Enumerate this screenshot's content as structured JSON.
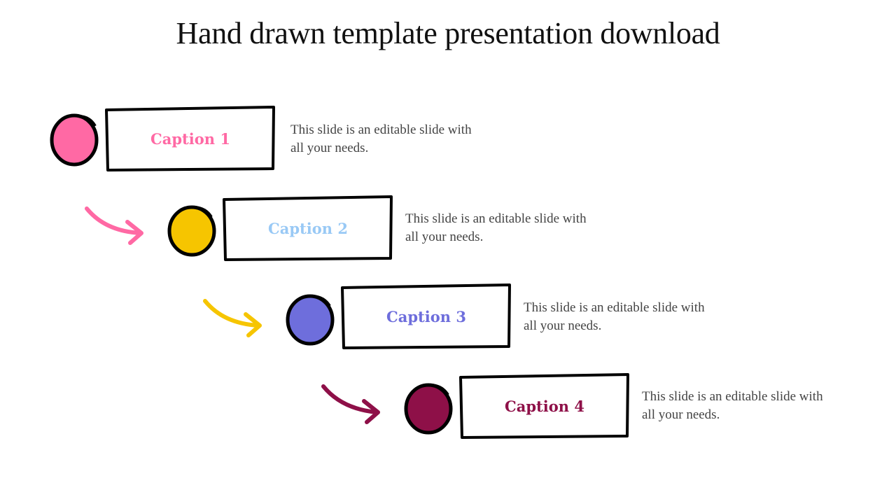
{
  "title": "Hand drawn template presentation download",
  "steps": [
    {
      "caption": "Caption 1",
      "description": "This slide is an editable slide with all your needs.",
      "dot_color": "#ff69a4",
      "caption_color": "#ff69a4",
      "arrow_color": null
    },
    {
      "caption": "Caption 2",
      "description": "This slide is an editable slide with all your needs.",
      "dot_color": "#f6c500",
      "caption_color": "#99c9f5",
      "arrow_color": "#ff69a4"
    },
    {
      "caption": "Caption 3",
      "description": "This slide is an editable slide with all your needs.",
      "dot_color": "#6e6edc",
      "caption_color": "#6e6edc",
      "arrow_color": "#f6c500"
    },
    {
      "caption": "Caption 4",
      "description": "This slide is an editable slide with all your needs.",
      "dot_color": "#8e1048",
      "caption_color": "#8e1048",
      "arrow_color": "#8e1048"
    }
  ],
  "icons": {
    "dot": "circle-marker-icon",
    "arrow": "curved-arrow-icon"
  }
}
